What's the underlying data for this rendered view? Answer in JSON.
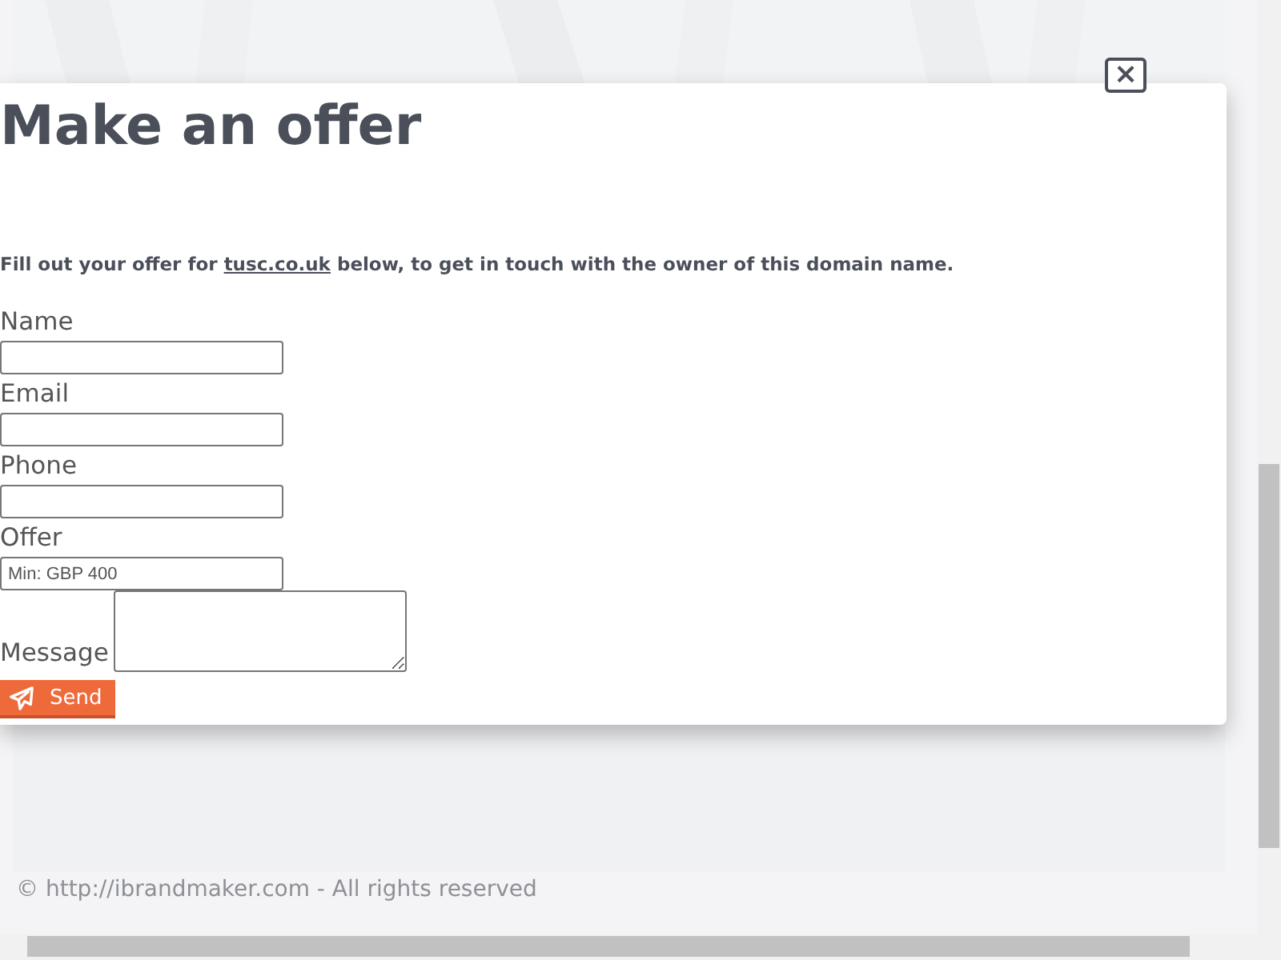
{
  "footer": {
    "copyright": "© http://ibrandmaker.com - All rights reserved"
  },
  "modal": {
    "close": "×",
    "title": "Make an offer",
    "description": {
      "before": "Fill out your offer for",
      "link": "tusc.co.uk",
      "after": "below, to get in touch with the owner of this domain name."
    },
    "fields": [
      {
        "kind": "input",
        "label": "Name"
      },
      {
        "kind": "input",
        "label": "Email"
      },
      {
        "kind": "input",
        "label": "Phone"
      },
      {
        "kind": "input",
        "label": "Offer",
        "placeholder": "Min: GBP 400"
      },
      {
        "kind": "textarea",
        "label": "Message"
      }
    ],
    "submit": "Send"
  }
}
